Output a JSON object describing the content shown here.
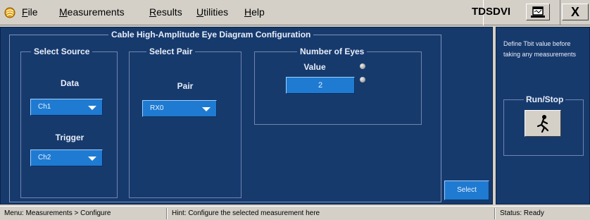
{
  "menu": {
    "file": {
      "u": "F",
      "rest": "ile"
    },
    "measurements": {
      "u": "M",
      "rest": "easurements"
    },
    "results": {
      "u": "R",
      "rest": "esults"
    },
    "utilities": {
      "u": "U",
      "rest": "tilities"
    },
    "help": {
      "u": "H",
      "rest": "elp"
    }
  },
  "brand": "TDSDVI",
  "close_label": "X",
  "config": {
    "title": "Cable High-Amplitude Eye Diagram Configuration",
    "source": {
      "title": "Select Source",
      "data_label": "Data",
      "data_value": "Ch1",
      "trigger_label": "Trigger",
      "trigger_value": "Ch2"
    },
    "pair": {
      "title": "Select Pair",
      "pair_label": "Pair",
      "pair_value": "RX0"
    },
    "eyes": {
      "title": "Number of Eyes",
      "value_label": "Value",
      "value": "2"
    },
    "select_label": "Select"
  },
  "sidebar": {
    "hint": "Define Tbit value before taking any measurements",
    "runstop_title": "Run/Stop"
  },
  "status": {
    "menu_path": "Menu: Measurements > Configure",
    "hint": "Hint: Configure the selected measurement here",
    "status": "Status: Ready"
  },
  "colors": {
    "panel": "#173a6d",
    "button": "#1f7ad1",
    "chrome": "#d4d0c8"
  },
  "icons": [
    "app-icon",
    "minimize-icon",
    "close-icon",
    "run-stop-icon",
    "chevron-down-icon"
  ]
}
